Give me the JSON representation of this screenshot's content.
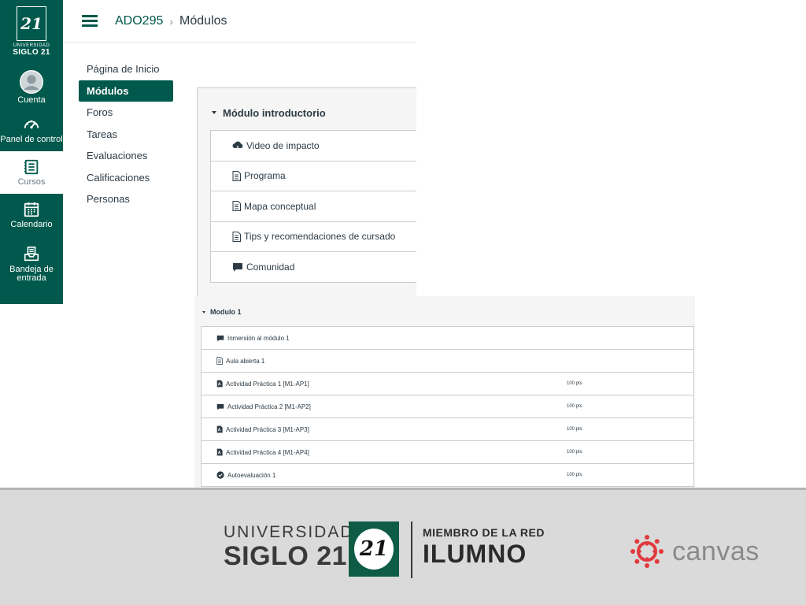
{
  "global_nav": {
    "logo": {
      "line1": "UNIVERSIDAD",
      "line2": "SIGLO 21",
      "mark": "21"
    },
    "items": [
      {
        "label": "Cuenta",
        "icon": "avatar-icon"
      },
      {
        "label": "Panel de control",
        "icon": "dashboard-icon"
      },
      {
        "label": "Cursos",
        "icon": "courses-icon",
        "active": true
      },
      {
        "label": "Calendario",
        "icon": "calendar-icon"
      },
      {
        "label": "Bandeja de entrada",
        "icon": "inbox-icon"
      }
    ]
  },
  "header": {
    "course": "ADO295",
    "separator": "›",
    "current": "Módulos"
  },
  "course_nav": {
    "items": [
      {
        "label": "Página de Inicio"
      },
      {
        "label": "Módulos",
        "active": true
      },
      {
        "label": "Foros"
      },
      {
        "label": "Tareas"
      },
      {
        "label": "Evaluaciones"
      },
      {
        "label": "Calificaciones"
      },
      {
        "label": "Personas"
      }
    ]
  },
  "modules": [
    {
      "title": "Módulo introductorio",
      "items": [
        {
          "label": "Video de impacto",
          "icon": "cloud-video-icon"
        },
        {
          "label": "Programa",
          "icon": "document-icon"
        },
        {
          "label": "Mapa conceptual",
          "icon": "document-icon"
        },
        {
          "label": "Tips y recomendaciones de cursado",
          "icon": "document-icon"
        },
        {
          "label": "Comunidad",
          "icon": "discussion-icon"
        }
      ]
    },
    {
      "title": "Modulo 1",
      "items": [
        {
          "label": "Inmersión al módulo 1",
          "icon": "discussion-icon",
          "points": ""
        },
        {
          "label": "Aula abierta 1",
          "icon": "document-icon",
          "points": ""
        },
        {
          "label": "Actividad Práctica 1 [M1-AP1]",
          "icon": "assignment-icon",
          "points": "100 pts"
        },
        {
          "label": "Actividad Práctica 2 [M1-AP2]",
          "icon": "discussion-icon",
          "points": "100 pts"
        },
        {
          "label": "Actividad Práctica 3 [M1-AP3]",
          "icon": "assignment-icon",
          "points": "100 pts"
        },
        {
          "label": "Actividad Práctica 4 [M1-AP4]",
          "icon": "assignment-icon",
          "points": "100 pts"
        },
        {
          "label": "Autoevaluación 1",
          "icon": "quiz-icon",
          "points": "100 pts"
        }
      ]
    }
  ],
  "footer": {
    "university_line1": "UNIVERSIDAD",
    "university_line2": "SIGLO 21",
    "crest_mark": "21",
    "network_line1": "MIEMBRO DE LA RED",
    "network_line2": "ILUMNO",
    "canvas_word": "canvas"
  },
  "colors": {
    "brand": "#00594c",
    "text": "#2d3b45",
    "banner": "#dadada",
    "canvas_red": "#e03a3e"
  }
}
